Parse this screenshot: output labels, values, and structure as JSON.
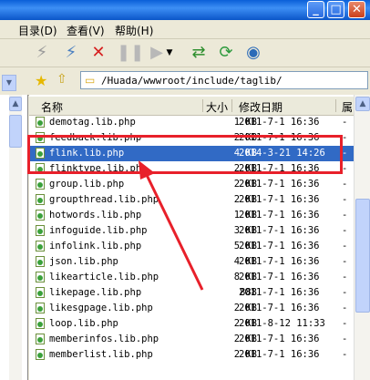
{
  "menu": {
    "directory": "目录(D)",
    "view": "查看(V)",
    "help": "帮助(H)"
  },
  "address": {
    "path": "/Huada/wwwroot/include/taglib/"
  },
  "columns": {
    "name": "名称",
    "size": "大小",
    "modified": "修改日期",
    "extra": "属"
  },
  "files": [
    {
      "name": "demotag.lib.php",
      "size": "1 KB",
      "date": "2011-7-1 16:36",
      "ext": "-"
    },
    {
      "name": "feedback.lib.php",
      "size": "2 KB",
      "date": "2011-7-1 16:36",
      "ext": "-"
    },
    {
      "name": "flink.lib.php",
      "size": "4 KB",
      "date": "2014-3-21 14:26",
      "ext": "-",
      "selected": true
    },
    {
      "name": "flinktype.lib.php",
      "size": "2 KB",
      "date": "2011-7-1 16:36",
      "ext": "-"
    },
    {
      "name": "group.lib.php",
      "size": "2 KB",
      "date": "2011-7-1 16:36",
      "ext": "-"
    },
    {
      "name": "groupthread.lib.php",
      "size": "2 KB",
      "date": "2011-7-1 16:36",
      "ext": "-"
    },
    {
      "name": "hotwords.lib.php",
      "size": "1 KB",
      "date": "2011-7-1 16:36",
      "ext": "-"
    },
    {
      "name": "infoguide.lib.php",
      "size": "3 KB",
      "date": "2011-7-1 16:36",
      "ext": "-"
    },
    {
      "name": "infolink.lib.php",
      "size": "5 KB",
      "date": "2011-7-1 16:36",
      "ext": "-"
    },
    {
      "name": "json.lib.php",
      "size": "4 KB",
      "date": "2011-7-1 16:36",
      "ext": "-"
    },
    {
      "name": "likearticle.lib.php",
      "size": "8 KB",
      "date": "2011-7-1 16:36",
      "ext": "-"
    },
    {
      "name": "likepage.lib.php",
      "size": "888",
      "date": "2011-7-1 16:36",
      "ext": "-"
    },
    {
      "name": "likesgpage.lib.php",
      "size": "2 KB",
      "date": "2011-7-1 16:36",
      "ext": "-"
    },
    {
      "name": "loop.lib.php",
      "size": "2 KB",
      "date": "2011-8-12 11:33",
      "ext": "-"
    },
    {
      "name": "memberinfos.lib.php",
      "size": "2 KB",
      "date": "2011-7-1 16:36",
      "ext": "-"
    },
    {
      "name": "memberlist.lib.php",
      "size": "2 KB",
      "date": "2011-7-1 16:36",
      "ext": "-"
    }
  ],
  "colors": {
    "selection": "#316ac5",
    "annotation": "#e8202a"
  }
}
